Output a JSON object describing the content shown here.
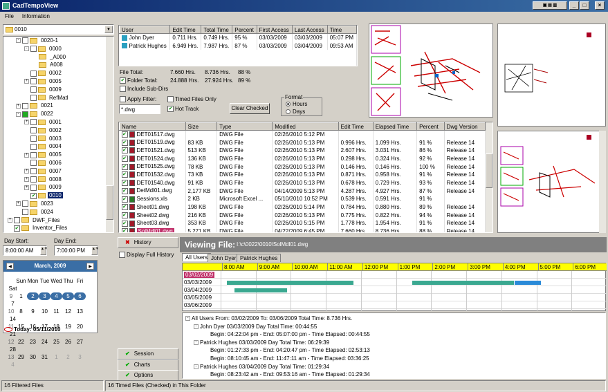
{
  "app": {
    "title": "CadTempoView"
  },
  "menu": [
    "File",
    "Information"
  ],
  "folder_combo": {
    "value": "0010"
  },
  "tree": [
    {
      "i": 1,
      "label": "0020-1",
      "tog": "-",
      "chk": true,
      "fold": true
    },
    {
      "i": 2,
      "label": "0000",
      "tog": "-",
      "chk": true,
      "fold": true
    },
    {
      "i": 3,
      "label": "_A000",
      "tog": "",
      "chk": false,
      "fold": true
    },
    {
      "i": 3,
      "label": "A008",
      "tog": "",
      "chk": false,
      "fold": true
    },
    {
      "i": 2,
      "label": "0002",
      "tog": "",
      "chk": true,
      "fold": true
    },
    {
      "i": 2,
      "label": "0005",
      "tog": "+",
      "chk": true,
      "fold": true
    },
    {
      "i": 2,
      "label": "0009",
      "tog": "",
      "chk": true,
      "fold": true
    },
    {
      "i": 2,
      "label": "RefMatl",
      "tog": "",
      "chk": true,
      "fold": true
    },
    {
      "i": 1,
      "label": "0021",
      "tog": "+",
      "chk": true,
      "fold": true
    },
    {
      "i": 1,
      "label": "0022",
      "tog": "-",
      "chk": true,
      "fold": true,
      "green": true
    },
    {
      "i": 2,
      "label": "0001",
      "tog": "+",
      "chk": true,
      "fold": true
    },
    {
      "i": 2,
      "label": "0002",
      "tog": "",
      "chk": true,
      "fold": true
    },
    {
      "i": 2,
      "label": "0003",
      "tog": "",
      "chk": true,
      "fold": true
    },
    {
      "i": 2,
      "label": "0004",
      "tog": "",
      "chk": true,
      "fold": true
    },
    {
      "i": 2,
      "label": "0005",
      "tog": "+",
      "chk": true,
      "fold": true
    },
    {
      "i": 2,
      "label": "0006",
      "tog": "",
      "chk": true,
      "fold": true
    },
    {
      "i": 2,
      "label": "0007",
      "tog": "+",
      "chk": true,
      "fold": true
    },
    {
      "i": 2,
      "label": "0008",
      "tog": "+",
      "chk": true,
      "fold": true
    },
    {
      "i": 2,
      "label": "0009",
      "tog": "+",
      "chk": true,
      "fold": true
    },
    {
      "i": 2,
      "label": "0010",
      "tog": "",
      "chk": true,
      "fold": true,
      "checked": true,
      "selected": true
    },
    {
      "i": 1,
      "label": "0023",
      "tog": "+",
      "chk": true,
      "fold": true
    },
    {
      "i": 1,
      "label": "0024",
      "tog": "",
      "chk": true,
      "fold": true
    },
    {
      "i": 0,
      "label": "DWF_Files",
      "tog": "+",
      "chk": true,
      "fold": true
    },
    {
      "i": 0,
      "label": "Inventor_Files",
      "tog": "",
      "chk": true,
      "fold": true,
      "checked": true
    }
  ],
  "users_table": {
    "headers": [
      "User",
      "Edit Time",
      "Total Time",
      "Percent",
      "First Access",
      "Last Access",
      "Time"
    ],
    "rows": [
      {
        "color": "#2aa0c0",
        "cells": [
          "John Dyer",
          "0.711 Hrs.",
          "0.749 Hrs.",
          "95 %",
          "03/03/2009",
          "03/03/2009",
          "05:07 PM"
        ]
      },
      {
        "color": "#2aa0c0",
        "cells": [
          "Patrick Hughes",
          "6.949 Hrs.",
          "7.987 Hrs.",
          "87 %",
          "03/03/2009",
          "03/04/2009",
          "09:53 AM"
        ]
      }
    ]
  },
  "totals": {
    "file_label": "File Total:",
    "file_edit": "7.660 Hrs.",
    "file_total": "8.736 Hrs.",
    "file_pct": "88 %",
    "folder_label": "Folder Total:",
    "folder_edit": "24.888 Hrs.",
    "folder_total": "27.924 Hrs.",
    "folder_pct": "89 %",
    "subdirs": "Include Sub-Dirs"
  },
  "filter": {
    "apply_label": "Apply Filter:",
    "timed_label": "Timed Files Only",
    "value": "*.dwg",
    "hot_label": "Hot Track",
    "clear_btn": "Clear Checked",
    "format_label": "Format",
    "hours": "Hours",
    "days": "Days"
  },
  "files_table": {
    "headers": [
      "Name",
      "Size",
      "Type",
      "Modified",
      "Edit Time",
      "Elapsed Time",
      "Percent",
      "Dwg Version"
    ],
    "rows": [
      [
        "DET01517.dwg",
        "",
        "DWG File",
        "02/26/2010 5:12 PM",
        "",
        "",
        "",
        ""
      ],
      [
        "DET01519.dwg",
        "83 KB",
        "DWG File",
        "02/26/2010 5:13 PM",
        "0.996 Hrs.",
        "1.099 Hrs.",
        "91 %",
        "Release 14"
      ],
      [
        "DET01521.dwg",
        "513 KB",
        "DWG File",
        "02/26/2010 5:13 PM",
        "2.607 Hrs.",
        "3.031 Hrs.",
        "86 %",
        "Release 14"
      ],
      [
        "DET01524.dwg",
        "136 KB",
        "DWG File",
        "02/26/2010 5:13 PM",
        "0.298 Hrs.",
        "0.324 Hrs.",
        "92 %",
        "Release 14"
      ],
      [
        "DET01525.dwg",
        "78 KB",
        "DWG File",
        "02/26/2010 5:13 PM",
        "0.146 Hrs.",
        "0.146 Hrs.",
        "100 %",
        "Release 14"
      ],
      [
        "DET01532.dwg",
        "73 KB",
        "DWG File",
        "02/26/2010 5:13 PM",
        "0.871 Hrs.",
        "0.958 Hrs.",
        "91 %",
        "Release 14"
      ],
      [
        "DET01540.dwg",
        "91 KB",
        "DWG File",
        "02/26/2010 5:13 PM",
        "0.678 Hrs.",
        "0.729 Hrs.",
        "93 %",
        "Release 14"
      ],
      [
        "DetMdl01.dwg",
        "2,177 KB",
        "DWG File",
        "04/14/2009 5:13 PM",
        "4.287 Hrs.",
        "4.927 Hrs.",
        "87 %",
        "Release 14"
      ],
      [
        "Sessions.xls",
        "2 KB",
        "Microsoft Excel ...",
        "05/10/2010 10:52 PM",
        "0.539 Hrs.",
        "0.591 Hrs.",
        "91 %",
        ""
      ],
      [
        "Sheet01.dwg",
        "198 KB",
        "DWG File",
        "02/26/2010 5:14 PM",
        "0.784 Hrs.",
        "0.880 Hrs.",
        "89 %",
        "Release 14"
      ],
      [
        "Sheet02.dwg",
        "216 KB",
        "DWG File",
        "02/26/2010 5:13 PM",
        "0.775 Hrs.",
        "0.822 Hrs.",
        "94 %",
        "Release 14"
      ],
      [
        "Sheet03.dwg",
        "353 KB",
        "DWG File",
        "02/26/2010 5:15 PM",
        "1.778 Hrs.",
        "1.954 Hrs.",
        "91 %",
        "Release 14"
      ],
      [
        "SolMdl01.dwg",
        "5,271 KB",
        "DWG File",
        "04/22/2009 6:45 PM",
        "7.660 Hrs.",
        "8.736 Hrs.",
        "88 %",
        "Release 14"
      ]
    ]
  },
  "dates": {
    "start_label": "Day Start:",
    "start_value": "8:00:00 AM",
    "end_label": "Day End:",
    "end_value": "7:00:00 PM"
  },
  "calendar": {
    "title": "March, 2009",
    "dow": [
      "Sun",
      "Mon",
      "Tue",
      "Wed",
      "Thu",
      "Fri",
      "Sat"
    ],
    "weeks": [
      {
        "wk": "",
        "days": [
          "",
          "",
          "",
          "",
          "",
          "",
          ""
        ]
      },
      {
        "wk": "9",
        "days": [
          "1",
          "2",
          "3",
          "4",
          "5",
          "6",
          "7"
        ]
      },
      {
        "wk": "10",
        "days": [
          "8",
          "9",
          "10",
          "11",
          "12",
          "13",
          "14"
        ]
      },
      {
        "wk": "11",
        "days": [
          "15",
          "16",
          "17",
          "18",
          "19",
          "20",
          "21"
        ]
      },
      {
        "wk": "12",
        "days": [
          "22",
          "23",
          "24",
          "25",
          "26",
          "27",
          "28"
        ]
      },
      {
        "wk": "13",
        "days": [
          "29",
          "30",
          "31",
          "1",
          "2",
          "3",
          "4"
        ]
      }
    ],
    "today": "Today: 05/11/2010"
  },
  "nav": {
    "history": "History",
    "display_full": "Display Full History",
    "session": "Session",
    "charts": "Charts",
    "options": "Options"
  },
  "viewing": {
    "label": "Viewing File:",
    "path": "I:\\c\\0022\\0010\\SolMdl01.dwg"
  },
  "tabs": [
    "All Users",
    "John Dyer",
    "Patrick Hughes"
  ],
  "timeline": {
    "hours": [
      "8:00 AM",
      "9:00 AM",
      "10:00 AM",
      "11:00 AM",
      "12:00 PM",
      "1:00 PM",
      "2:00 PM",
      "3:00 PM",
      "4:00 PM",
      "5:00 PM",
      "6:00 PM"
    ],
    "dates": [
      "03/02/2009",
      "03/03/2009",
      "03/04/2009",
      "03/05/2009",
      "03/06/2009"
    ]
  },
  "history_tree": [
    "All Users  From: 03/02/2009 To: 03/06/2009  Total Time: 8.736 Hrs.",
    "John Dyer  03/03/2009    Day Total Time: 00:44:55",
    "Begin:  04:22:04 pm  - End:  05:07:00 pm - Time Elapsed: 00:44:55",
    "Patrick Hughes  03/03/2009    Day Total Time: 06:29:39",
    "Begin:  01:27:33 pm  - End:  04:20:47 pm - Time Elapsed: 02:53:13",
    "Begin:  08:10:45 am  - End:  11:47:11 am - Time Elapsed: 03:36:25",
    "Patrick Hughes  03/04/2009    Day Total Time: 01:29:34",
    "Begin:  08:23:42 am  - End:  09:53:16 am - Time Elapsed: 01:29:34"
  ],
  "status": {
    "left": "16 Filtered Files",
    "right": "16 Timed Files (Checked) in This Folder"
  },
  "colors": {
    "bar_teal": "#3aa890",
    "bar_blue": "#2a8ad8",
    "selected_date": "#c0306a",
    "hours_yellow": "#ffff00"
  }
}
